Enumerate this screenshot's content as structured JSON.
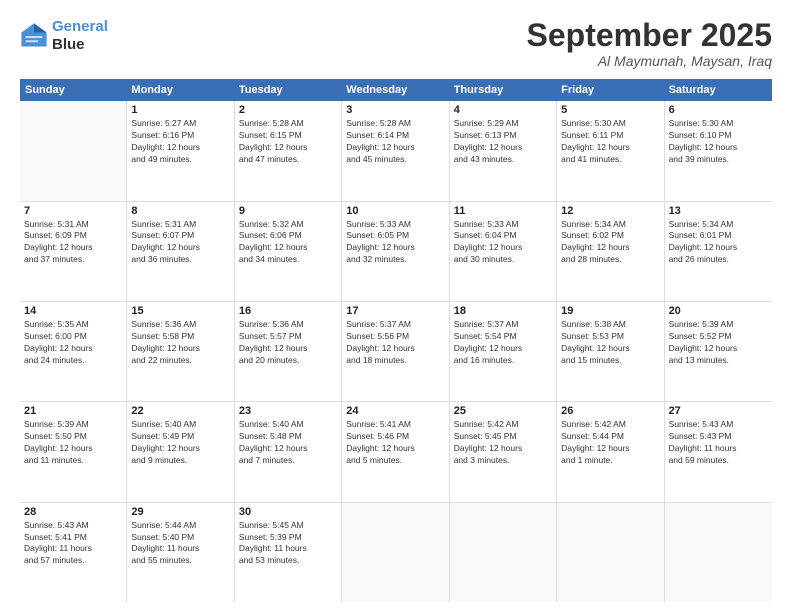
{
  "logo": {
    "line1": "General",
    "line2": "Blue"
  },
  "title": "September 2025",
  "location": "Al Maymunah, Maysan, Iraq",
  "header_days": [
    "Sunday",
    "Monday",
    "Tuesday",
    "Wednesday",
    "Thursday",
    "Friday",
    "Saturday"
  ],
  "rows": [
    [
      {
        "day": "",
        "info": ""
      },
      {
        "day": "1",
        "info": "Sunrise: 5:27 AM\nSunset: 6:16 PM\nDaylight: 12 hours\nand 49 minutes."
      },
      {
        "day": "2",
        "info": "Sunrise: 5:28 AM\nSunset: 6:15 PM\nDaylight: 12 hours\nand 47 minutes."
      },
      {
        "day": "3",
        "info": "Sunrise: 5:28 AM\nSunset: 6:14 PM\nDaylight: 12 hours\nand 45 minutes."
      },
      {
        "day": "4",
        "info": "Sunrise: 5:29 AM\nSunset: 6:13 PM\nDaylight: 12 hours\nand 43 minutes."
      },
      {
        "day": "5",
        "info": "Sunrise: 5:30 AM\nSunset: 6:11 PM\nDaylight: 12 hours\nand 41 minutes."
      },
      {
        "day": "6",
        "info": "Sunrise: 5:30 AM\nSunset: 6:10 PM\nDaylight: 12 hours\nand 39 minutes."
      }
    ],
    [
      {
        "day": "7",
        "info": "Sunrise: 5:31 AM\nSunset: 6:09 PM\nDaylight: 12 hours\nand 37 minutes."
      },
      {
        "day": "8",
        "info": "Sunrise: 5:31 AM\nSunset: 6:07 PM\nDaylight: 12 hours\nand 36 minutes."
      },
      {
        "day": "9",
        "info": "Sunrise: 5:32 AM\nSunset: 6:06 PM\nDaylight: 12 hours\nand 34 minutes."
      },
      {
        "day": "10",
        "info": "Sunrise: 5:33 AM\nSunset: 6:05 PM\nDaylight: 12 hours\nand 32 minutes."
      },
      {
        "day": "11",
        "info": "Sunrise: 5:33 AM\nSunset: 6:04 PM\nDaylight: 12 hours\nand 30 minutes."
      },
      {
        "day": "12",
        "info": "Sunrise: 5:34 AM\nSunset: 6:02 PM\nDaylight: 12 hours\nand 28 minutes."
      },
      {
        "day": "13",
        "info": "Sunrise: 5:34 AM\nSunset: 6:01 PM\nDaylight: 12 hours\nand 26 minutes."
      }
    ],
    [
      {
        "day": "14",
        "info": "Sunrise: 5:35 AM\nSunset: 6:00 PM\nDaylight: 12 hours\nand 24 minutes."
      },
      {
        "day": "15",
        "info": "Sunrise: 5:36 AM\nSunset: 5:58 PM\nDaylight: 12 hours\nand 22 minutes."
      },
      {
        "day": "16",
        "info": "Sunrise: 5:36 AM\nSunset: 5:57 PM\nDaylight: 12 hours\nand 20 minutes."
      },
      {
        "day": "17",
        "info": "Sunrise: 5:37 AM\nSunset: 5:56 PM\nDaylight: 12 hours\nand 18 minutes."
      },
      {
        "day": "18",
        "info": "Sunrise: 5:37 AM\nSunset: 5:54 PM\nDaylight: 12 hours\nand 16 minutes."
      },
      {
        "day": "19",
        "info": "Sunrise: 5:38 AM\nSunset: 5:53 PM\nDaylight: 12 hours\nand 15 minutes."
      },
      {
        "day": "20",
        "info": "Sunrise: 5:39 AM\nSunset: 5:52 PM\nDaylight: 12 hours\nand 13 minutes."
      }
    ],
    [
      {
        "day": "21",
        "info": "Sunrise: 5:39 AM\nSunset: 5:50 PM\nDaylight: 12 hours\nand 11 minutes."
      },
      {
        "day": "22",
        "info": "Sunrise: 5:40 AM\nSunset: 5:49 PM\nDaylight: 12 hours\nand 9 minutes."
      },
      {
        "day": "23",
        "info": "Sunrise: 5:40 AM\nSunset: 5:48 PM\nDaylight: 12 hours\nand 7 minutes."
      },
      {
        "day": "24",
        "info": "Sunrise: 5:41 AM\nSunset: 5:46 PM\nDaylight: 12 hours\nand 5 minutes."
      },
      {
        "day": "25",
        "info": "Sunrise: 5:42 AM\nSunset: 5:45 PM\nDaylight: 12 hours\nand 3 minutes."
      },
      {
        "day": "26",
        "info": "Sunrise: 5:42 AM\nSunset: 5:44 PM\nDaylight: 12 hours\nand 1 minute."
      },
      {
        "day": "27",
        "info": "Sunrise: 5:43 AM\nSunset: 5:43 PM\nDaylight: 11 hours\nand 59 minutes."
      }
    ],
    [
      {
        "day": "28",
        "info": "Sunrise: 5:43 AM\nSunset: 5:41 PM\nDaylight: 11 hours\nand 57 minutes."
      },
      {
        "day": "29",
        "info": "Sunrise: 5:44 AM\nSunset: 5:40 PM\nDaylight: 11 hours\nand 55 minutes."
      },
      {
        "day": "30",
        "info": "Sunrise: 5:45 AM\nSunset: 5:39 PM\nDaylight: 11 hours\nand 53 minutes."
      },
      {
        "day": "",
        "info": ""
      },
      {
        "day": "",
        "info": ""
      },
      {
        "day": "",
        "info": ""
      },
      {
        "day": "",
        "info": ""
      }
    ]
  ]
}
